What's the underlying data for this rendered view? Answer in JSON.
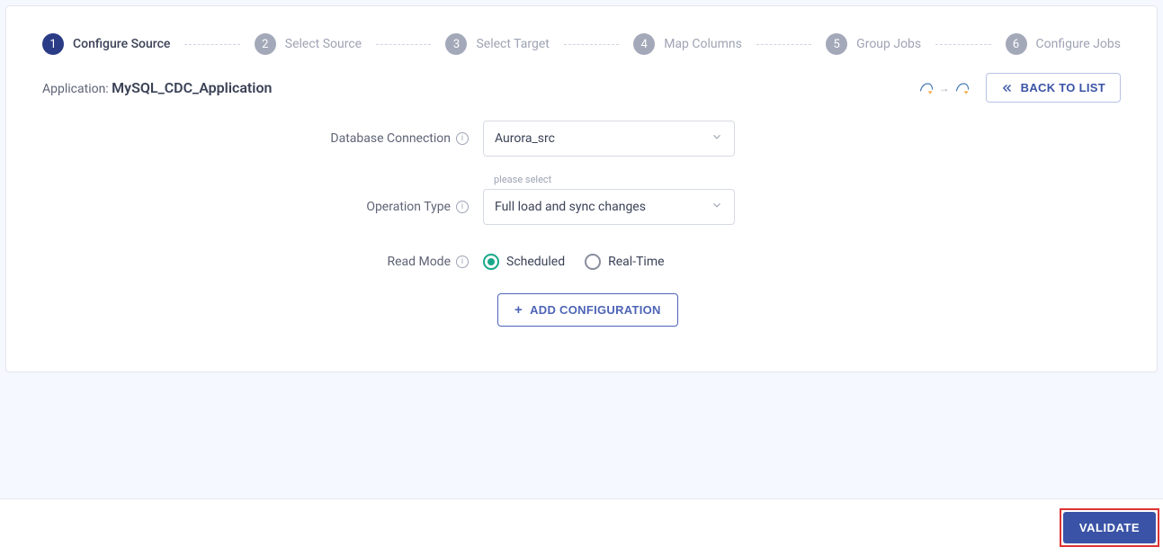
{
  "stepper": {
    "steps": [
      {
        "num": "1",
        "label": "Configure Source",
        "active": true
      },
      {
        "num": "2",
        "label": "Select Source",
        "active": false
      },
      {
        "num": "3",
        "label": "Select Target",
        "active": false
      },
      {
        "num": "4",
        "label": "Map Columns",
        "active": false
      },
      {
        "num": "5",
        "label": "Group Jobs",
        "active": false
      },
      {
        "num": "6",
        "label": "Configure Jobs",
        "active": false
      }
    ]
  },
  "header": {
    "application_label": "Application: ",
    "application_name": "MySQL_CDC_Application",
    "back_to_list": "BACK TO LIST"
  },
  "form": {
    "db_connection_label": "Database Connection",
    "db_connection_value": "Aurora_src",
    "operation_type_label": "Operation Type",
    "operation_type_floating": "please select",
    "operation_type_value": "Full load and sync changes",
    "read_mode_label": "Read Mode",
    "read_mode_options": {
      "scheduled": "Scheduled",
      "realtime": "Real-Time"
    },
    "read_mode_selected": "scheduled",
    "add_configuration": "ADD CONFIGURATION"
  },
  "footer": {
    "validate": "VALIDATE"
  }
}
